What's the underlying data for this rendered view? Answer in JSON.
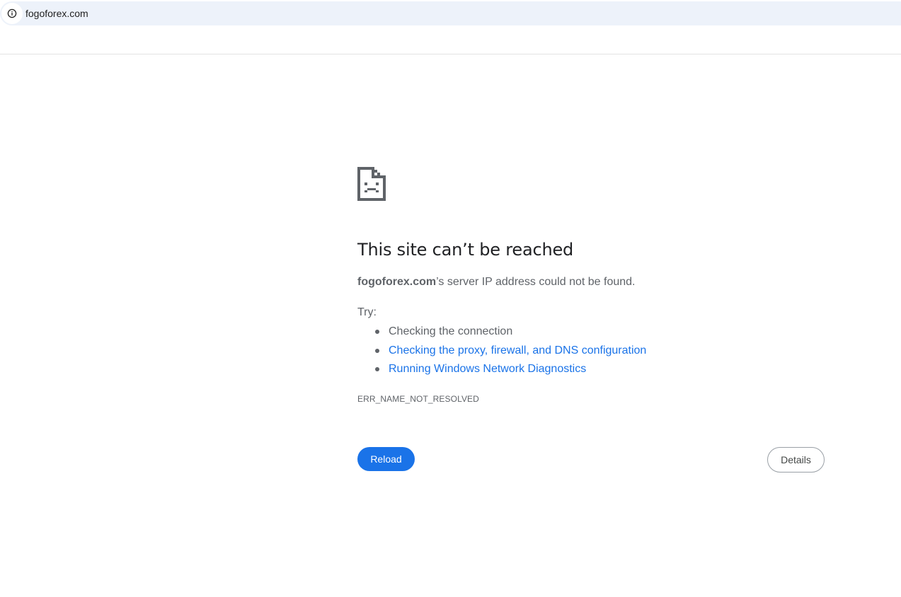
{
  "address_bar": {
    "url": "fogoforex.com",
    "site_info_icon": "info-circle-icon"
  },
  "error_page": {
    "icon": "sad-page-icon",
    "title": "This site can’t be reached",
    "description": {
      "domain": "fogoforex.com",
      "message": "’s server IP address could not be found."
    },
    "try_label": "Try:",
    "suggestions": [
      {
        "text": "Checking the connection",
        "is_link": false
      },
      {
        "text": "Checking the proxy, firewall, and DNS configuration",
        "is_link": true
      },
      {
        "text": "Running Windows Network Diagnostics",
        "is_link": true
      }
    ],
    "error_code": "ERR_NAME_NOT_RESOLVED",
    "reload_label": "Reload",
    "details_label": "Details"
  },
  "colors": {
    "address_bar_bg": "#edf2fa",
    "link": "#1a73e8",
    "primary_button": "#1a73e8",
    "body_text": "#5f6368",
    "title_text": "#202124"
  }
}
